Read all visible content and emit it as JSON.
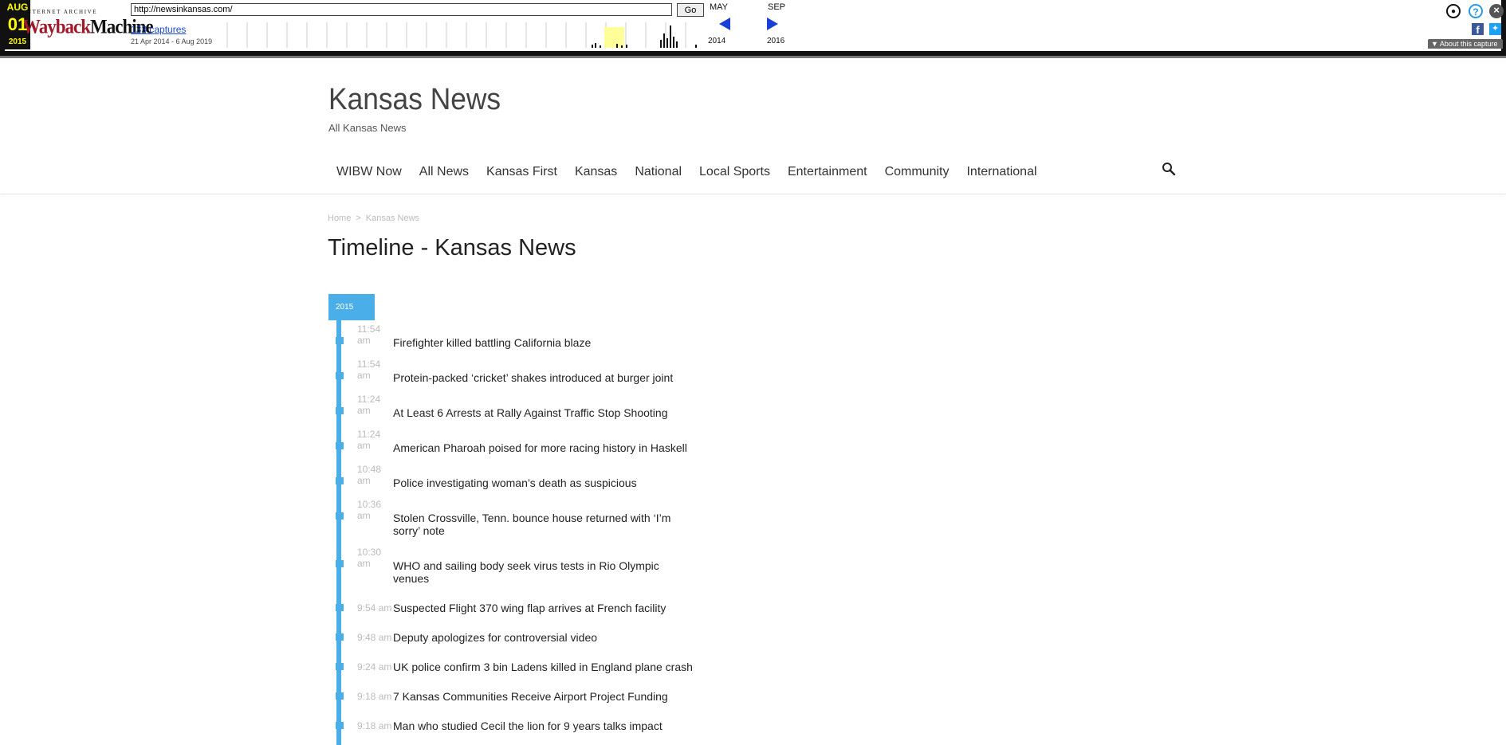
{
  "wayback": {
    "logo_top": "INTERNET ARCHIVE",
    "logo_main_a": "Wayback",
    "logo_main_b": "Machine",
    "url": "http://newsinkansas.com/",
    "go_label": "Go",
    "captures": "133 captures",
    "range": "21 Apr 2014 - 6 Aug 2019",
    "prev_month": "MAY",
    "cur_month": "AUG",
    "cur_day": "01",
    "cur_year": "2015",
    "next_month": "SEP",
    "prev_year": "2014",
    "next_year": "2016",
    "about": "About this capture",
    "icons": [
      "user-icon",
      "help-icon",
      "close-icon",
      "facebook-icon",
      "twitter-icon"
    ],
    "colors": {
      "highlight": "#ffff00",
      "arrow": "#1a3ed8"
    }
  },
  "site": {
    "title": "Kansas News",
    "tagline": "All Kansas News",
    "nav": [
      "WIBW Now",
      "All News",
      "Kansas First",
      "Kansas",
      "National",
      "Local Sports",
      "Entertainment",
      "Community",
      "International"
    ],
    "search_icon": "search-icon"
  },
  "breadcrumb": {
    "home": "Home",
    "sep": ">",
    "current": "Kansas News"
  },
  "page_title": "Timeline - Kansas News",
  "timeline": {
    "year": "2015",
    "accent": "#4aaee8",
    "items": [
      {
        "time": "11:54 am",
        "title": "Firefighter killed battling California blaze"
      },
      {
        "time": "11:54 am",
        "title": "Protein-packed ‘cricket’ shakes introduced at burger joint"
      },
      {
        "time": "11:24 am",
        "title": "At Least 6 Arrests at Rally Against Traffic Stop Shooting"
      },
      {
        "time": "11:24 am",
        "title": "American Pharoah poised for more racing history in Haskell"
      },
      {
        "time": "10:48 am",
        "title": "Police investigating woman’s death as suspicious"
      },
      {
        "time": "10:36 am",
        "title": "Stolen Crossville, Tenn. bounce house returned with ‘I’m sorry’ note"
      },
      {
        "time": "10:30 am",
        "title": "WHO and sailing body seek virus tests in Rio Olympic venues"
      },
      {
        "time": "9:54 am",
        "title": "Suspected Flight 370 wing flap arrives at French facility"
      },
      {
        "time": "9:48 am",
        "title": "Deputy apologizes for controversial video"
      },
      {
        "time": "9:24 am",
        "title": "UK police confirm 3 bin Ladens killed in England plane crash"
      },
      {
        "time": "9:18 am",
        "title": "7 Kansas Communities Receive Airport Project Funding"
      },
      {
        "time": "9:18 am",
        "title": "Man who studied Cecil the lion for 9 years talks impact"
      }
    ]
  }
}
